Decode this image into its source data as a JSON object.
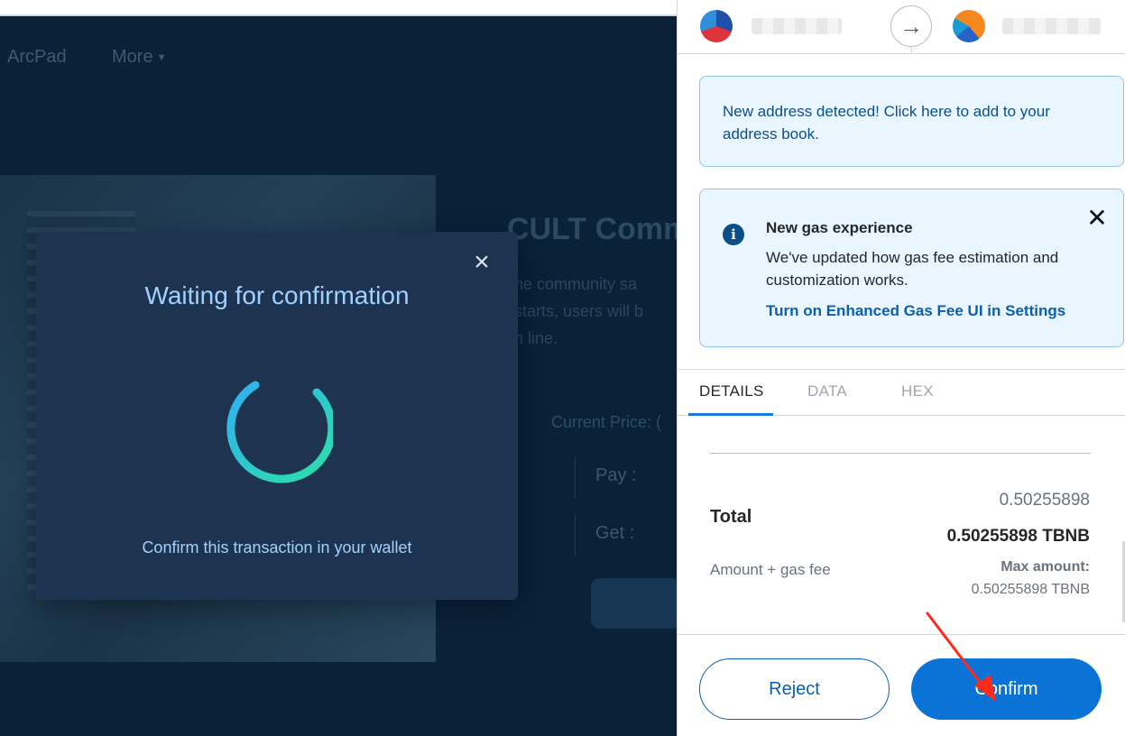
{
  "dapp": {
    "nav": {
      "arcpad": "ArcPad",
      "more": "More"
    },
    "hero": {
      "title": "CULT Comm",
      "line_1": "he community sa",
      "line_2": "starts, users will b",
      "line_3": "n line."
    },
    "current_price_label": "Current Price: (",
    "pay_label": "Pay :",
    "get_label": "Get :"
  },
  "modal": {
    "title": "Waiting for confirmation",
    "subtitle": "Confirm this transaction in your wallet",
    "close_icon": "×",
    "spinner_colors": [
      "#2fb0f0",
      "#2de0a8"
    ]
  },
  "wallet": {
    "accounts": {
      "from_name": "",
      "to_name": "",
      "arrow_icon": "→"
    },
    "new_address_alert": "New address detected! Click here to add to your address book.",
    "gas_alert": {
      "title": "New gas experience",
      "description": "We've updated how gas fee estimation and customization works.",
      "link": "Turn on Enhanced Gas Fee UI in Settings",
      "close_icon": "✕",
      "info_icon": "i"
    },
    "tabs": {
      "details": "DETAILS",
      "data": "DATA",
      "hex": "HEX"
    },
    "total": {
      "label": "Total",
      "fiat_value": "0.50255898",
      "amount": "0.50255898 TBNB",
      "amount_gas_label": "Amount + gas fee",
      "max_label": "Max amount:",
      "max_value": "0.50255898 TBNB"
    },
    "buttons": {
      "reject": "Reject",
      "confirm": "Confirm"
    },
    "colors": {
      "primary": "#0b72d6",
      "alert_bg": "#eaf6ff",
      "annotation_arrow": "#ff2a1a"
    }
  }
}
